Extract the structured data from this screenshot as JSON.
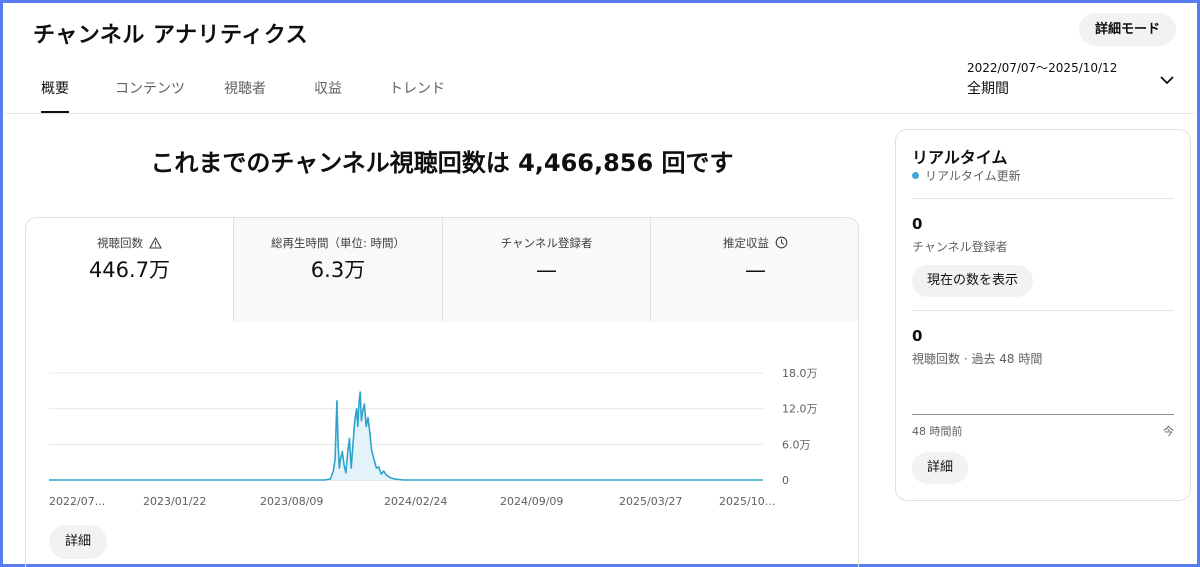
{
  "header": {
    "title": "チャンネル アナリティクス",
    "advanced_mode_label": "詳細モード"
  },
  "tabs": [
    {
      "label": "概要",
      "active": true
    },
    {
      "label": "コンテンツ",
      "active": false
    },
    {
      "label": "視聴者",
      "active": false
    },
    {
      "label": "収益",
      "active": false
    },
    {
      "label": "トレンド",
      "active": false
    }
  ],
  "date_range": {
    "dates": "2022/07/07～2025/10/12",
    "period": "全期間",
    "icon": "chevron-down-icon"
  },
  "headline": "これまでのチャンネル視聴回数は 4,466,856 回です",
  "metrics": [
    {
      "label": "視聴回数",
      "value": "446.7万",
      "icon": "warning-icon"
    },
    {
      "label": "総再生時間（単位: 時間）",
      "value": "6.3万",
      "icon": ""
    },
    {
      "label": "チャンネル登録者",
      "value": "—",
      "icon": ""
    },
    {
      "label": "推定収益",
      "value": "—",
      "icon": "clock-icon"
    }
  ],
  "main_detail_label": "詳細",
  "realtime": {
    "title": "リアルタイム",
    "subtitle": "リアルタイム更新",
    "subscribers_value": "0",
    "subscribers_label": "チャンネル登録者",
    "show_count_label": "現在の数を表示",
    "views_value": "0",
    "views_label": "視聴回数 · 過去 48 時間",
    "axis_start": "48 時間前",
    "axis_end": "今",
    "detail_label": "詳細"
  },
  "colors": {
    "line": "#2ea3cc",
    "fill": "#e4f3fa",
    "accent_dot": "#3ea6d8"
  },
  "chart_data": {
    "type": "area",
    "title": "",
    "xlabel": "",
    "ylabel": "",
    "x_tick_labels": [
      "2022/07...",
      "2023/01/22",
      "2023/08/09",
      "2024/02/24",
      "2024/09/09",
      "2025/03/27",
      "2025/10..."
    ],
    "x_range": [
      "2022-07-07",
      "2025-10-12"
    ],
    "y_tick_labels": [
      "0",
      "6.0万",
      "12.0万",
      "18.0万"
    ],
    "y_ticks": [
      0,
      60000,
      120000,
      180000
    ],
    "ylim": [
      0,
      180000
    ],
    "grid": true,
    "x": [
      "2022-07-07",
      "2023-10-10",
      "2023-10-20",
      "2023-10-25",
      "2023-10-28",
      "2023-10-31",
      "2023-11-02",
      "2023-11-04",
      "2023-11-06",
      "2023-11-09",
      "2023-11-12",
      "2023-11-15",
      "2023-11-18",
      "2023-11-21",
      "2023-11-24",
      "2023-11-27",
      "2023-11-30",
      "2023-12-03",
      "2023-12-05",
      "2023-12-07",
      "2023-12-09",
      "2023-12-11",
      "2023-12-13",
      "2023-12-16",
      "2023-12-19",
      "2023-12-22",
      "2023-12-25",
      "2023-12-28",
      "2024-01-01",
      "2024-01-05",
      "2024-01-09",
      "2024-01-13",
      "2024-01-17",
      "2024-01-22",
      "2024-01-28",
      "2024-02-05",
      "2024-02-20",
      "2025-10-12"
    ],
    "values": [
      0,
      0,
      1500,
      15000,
      35000,
      133000,
      60000,
      20000,
      35000,
      48000,
      25000,
      12000,
      45000,
      70000,
      20000,
      60000,
      100000,
      120000,
      90000,
      130000,
      148000,
      100000,
      115000,
      128000,
      90000,
      105000,
      80000,
      50000,
      35000,
      20000,
      22000,
      10000,
      15000,
      8000,
      4000,
      1500,
      0,
      0
    ]
  }
}
